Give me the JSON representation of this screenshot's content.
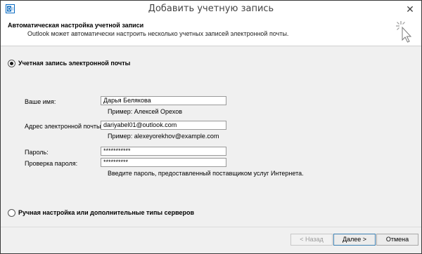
{
  "window": {
    "title": "Добавить учетную запись",
    "close_glyph": "✕"
  },
  "header": {
    "title": "Автоматическая настройка учетной записи",
    "subtitle": "Outlook может автоматически настроить несколько учетных записей электронной почты."
  },
  "options": {
    "email_account_label": "Учетная запись электронной почты",
    "manual_setup_label": "Ручная настройка или дополнительные типы серверов",
    "selected": "email_account"
  },
  "form": {
    "name_label": "Ваше имя:",
    "name_value": "Дарья Белякова",
    "name_hint": "Пример: Алексей Орехов",
    "email_label": "Адрес электронной почты:",
    "email_value": "dariyabel01@outlook.com",
    "email_hint": "Пример: alexeyorekhov@example.com",
    "password_label": "Пароль:",
    "password_value": "***********",
    "confirm_label": "Проверка пароля:",
    "confirm_value": "**********",
    "password_hint": "Введите пароль, предоставленный поставщиком услуг Интернета."
  },
  "buttons": {
    "back": "< Назад",
    "next": "Далее >",
    "cancel": "Отмена"
  },
  "icons": {
    "app_icon": "outlook-icon",
    "header_icon": "magic-wand-cursor-icon"
  },
  "colors": {
    "primary_button_border": "#3c7fb1",
    "window_bg": "#f0f0f0"
  }
}
